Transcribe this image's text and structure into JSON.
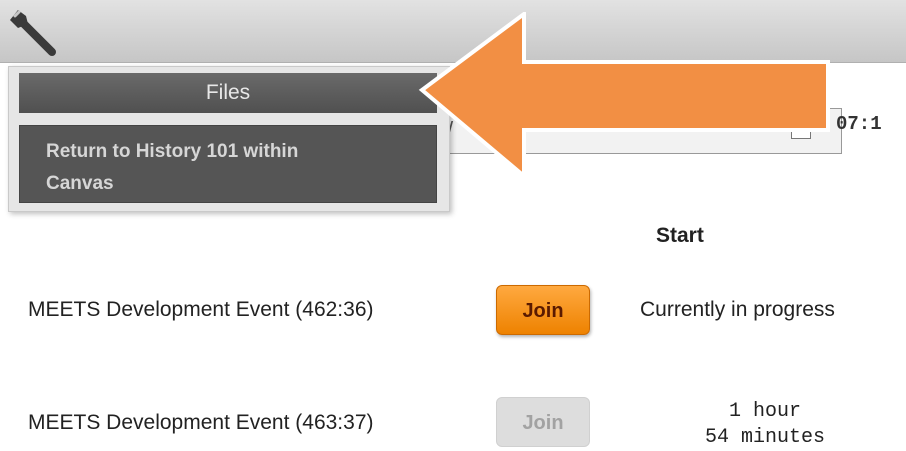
{
  "toolbar": {
    "tools_icon": "wrench-icon",
    "behind_text": "/",
    "clock": "07:1"
  },
  "menu": {
    "files_label": "Files",
    "return_line1": "Return to History 101 within",
    "return_line2": "Canvas"
  },
  "annotation": {
    "arrow_color": "#f28f44",
    "arrow_outline": "#ffffff"
  },
  "table": {
    "start_header": "Start",
    "rows": [
      {
        "name": "MEETS Development Event (462:36)",
        "join_label": "Join",
        "join_enabled": true,
        "start": "Currently in progress"
      },
      {
        "name": "MEETS Development Event (463:37)",
        "join_label": "Join",
        "join_enabled": false,
        "start_line1": "1 hour",
        "start_line2": "54 minutes"
      }
    ]
  },
  "colors": {
    "join_active": "#f58a0b",
    "join_disabled": "#dddddd",
    "menu_dark": "#555555"
  }
}
